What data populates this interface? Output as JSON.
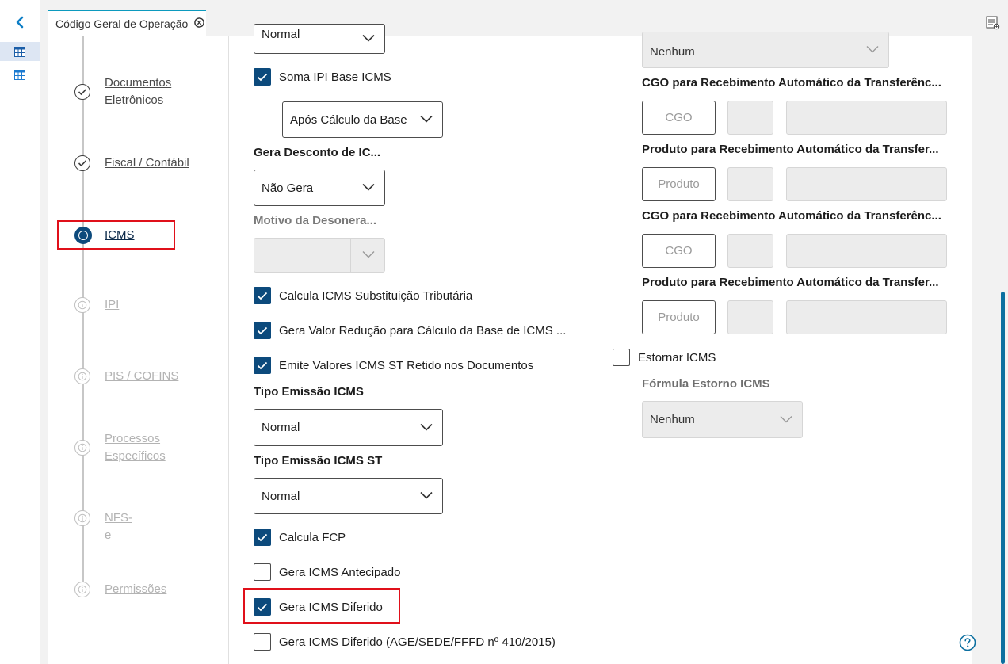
{
  "tab": {
    "title": "Código Geral de Operação"
  },
  "steps": [
    {
      "label": "Documentos Eletrônicos",
      "state": "done"
    },
    {
      "label": "Fiscal / Contábil",
      "state": "done"
    },
    {
      "label": "ICMS",
      "state": "active"
    },
    {
      "label": "IPI",
      "state": "disabled"
    },
    {
      "label": "PIS / COFINS",
      "state": "disabled"
    },
    {
      "label": "Processos Específicos",
      "state": "disabled"
    },
    {
      "label": "NFS-e",
      "state": "disabled"
    },
    {
      "label": "Permissões",
      "state": "disabled"
    }
  ],
  "form": {
    "top_select_value": "Normal",
    "soma_ipi_label": "Soma IPI Base ICMS",
    "apos_calculo_value": "Após Cálculo da Base",
    "gera_desconto_label": "Gera Desconto de IC...",
    "gera_desconto_value": "Não Gera",
    "motivo_label": "Motivo da Desonera...",
    "motivo_value": "",
    "calcula_st_label": "Calcula ICMS Substituição Tributária",
    "gera_valor_reducao_label": "Gera Valor Redução para Cálculo da Base de ICMS ...",
    "emite_valores_label": "Emite Valores ICMS ST Retido nos Documentos",
    "tipo_emissao_label": "Tipo Emissão ICMS",
    "tipo_emissao_value": "Normal",
    "tipo_emissao_st_label": "Tipo Emissão ICMS ST",
    "tipo_emissao_st_value": "Normal",
    "calcula_fcp_label": "Calcula FCP",
    "gera_antecipado_label": "Gera ICMS Antecipado",
    "gera_diferido_label": "Gera ICMS Diferido",
    "gera_diferido_age_label": "Gera ICMS Diferido (AGE/SEDE/FFFD nº 410/2015)"
  },
  "right": {
    "top_select_value": "Nenhum",
    "cgo_transf_1_label": "CGO para Recebimento Automático da Transferênc...",
    "cgo_placeholder": "CGO",
    "prod_transf_1_label": "Produto para Recebimento Automático da Transfer...",
    "prod_placeholder": "Produto",
    "cgo_transf_2_label": "CGO para Recebimento Automático da Transferênc...",
    "prod_transf_2_label": "Produto para Recebimento Automático da Transfer...",
    "estornar_label": "Estornar ICMS",
    "formula_label": "Fórmula Estorno ICMS",
    "formula_value": "Nenhum"
  },
  "colors": {
    "accent": "#0c4a7c",
    "tab_border": "#0c9abe",
    "highlight": "#e0101a"
  }
}
